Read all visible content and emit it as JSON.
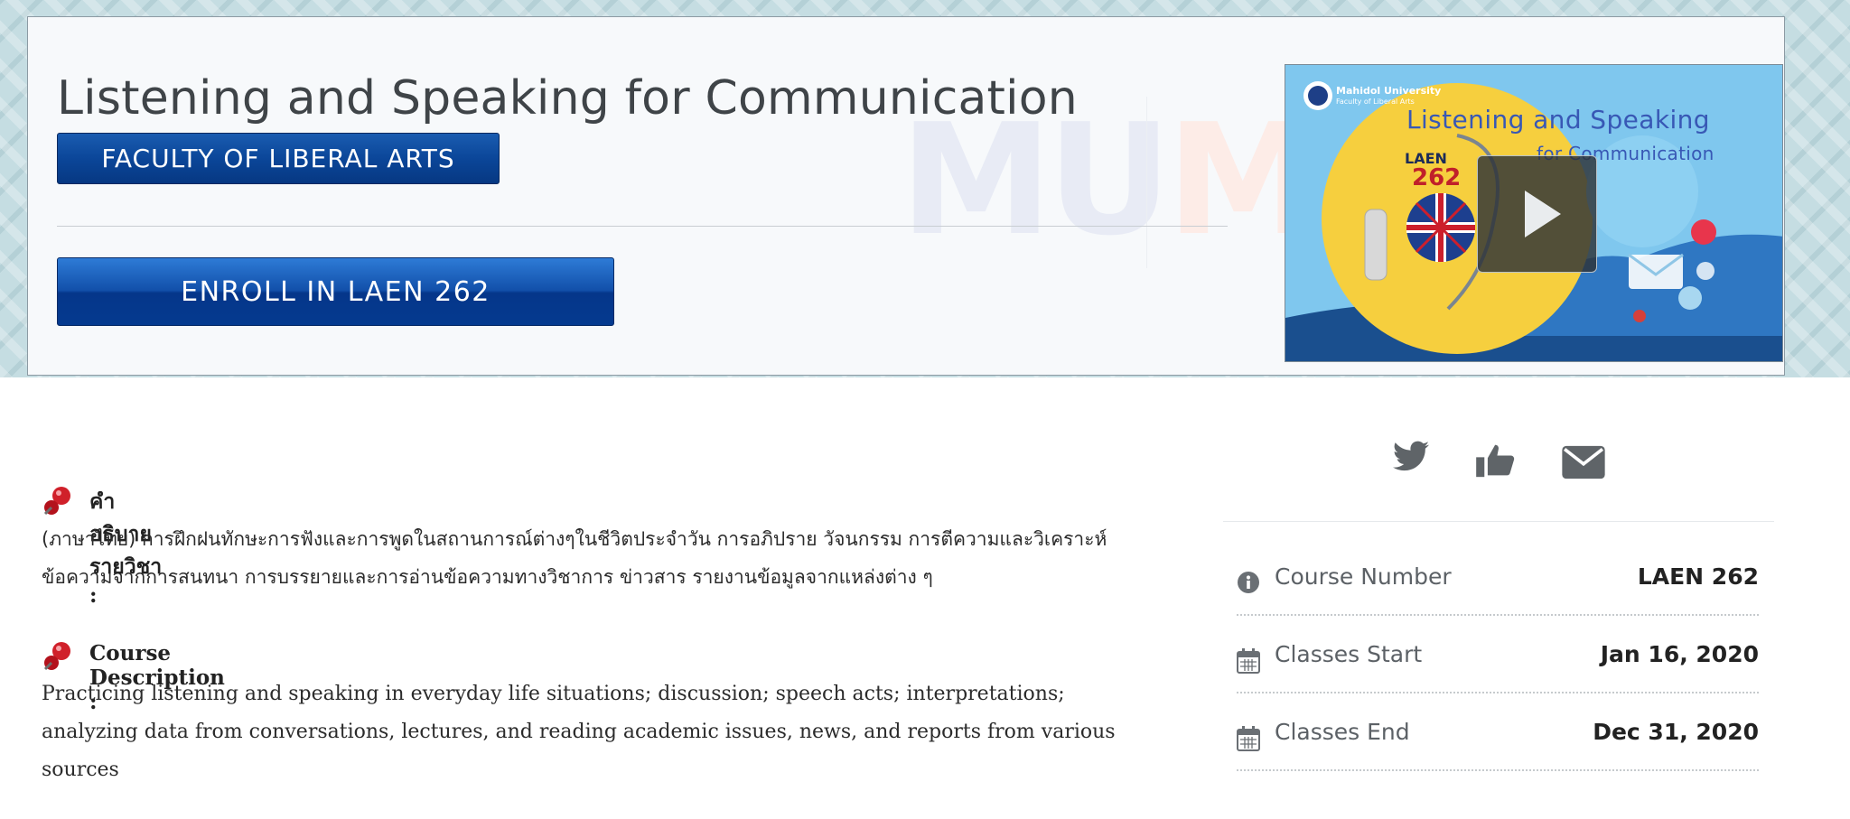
{
  "course": {
    "title": "Listening and Speaking for Communication",
    "organization": "FACULTY OF LIBERAL ARTS",
    "enroll_label": "ENROLL IN LAEN 262",
    "watermark_mu": "MU",
    "watermark_m": "M"
  },
  "video": {
    "university": "Mahidol University",
    "faculty": "Faculty of Liberal Arts",
    "title_line1": "Listening and Speaking",
    "title_line2": "for Communication",
    "course_code_text": "LAEN",
    "course_code_number": "262",
    "play_icon": "play-icon"
  },
  "description": {
    "thai_heading": "คำอธิบายรายวิชา :",
    "thai_line1": "(ภาษาไทย) การฝึกฝนทักษะการฟังและการพูดในสถานการณ์ต่างๆในชีวิตประจำวัน การอภิปราย วัจนกรรม การตีความและวิเคราะห์",
    "thai_line2": "ข้อความจากการสนทนา การบรรยายและการอ่านข้อความทางวิชาการ ข่าวสาร รายงานข้อมูลจากแหล่งต่าง ๆ",
    "english_heading": "Course Description :",
    "english_line1": "Practicing listening and speaking in everyday life situations; discussion; speech acts; interpretations;",
    "english_line2": "analyzing data from conversations, lectures, and reading academic issues, news, and reports from various",
    "english_line3": "sources"
  },
  "social": {
    "icons": [
      "twitter-icon",
      "thumbs-up-icon",
      "envelope-icon"
    ],
    "color": "#5f6468"
  },
  "course_info": [
    {
      "icon": "info-icon",
      "label": "Course Number",
      "value": "LAEN 262"
    },
    {
      "icon": "calendar-icon",
      "label": "Classes Start",
      "value": "Jan 16, 2020"
    },
    {
      "icon": "calendar-icon",
      "label": "Classes End",
      "value": "Dec 31, 2020"
    }
  ],
  "colors": {
    "brand_blue": "#0b4699",
    "pin_red": "#d0202a",
    "hero_bg": "#c5dde2"
  }
}
